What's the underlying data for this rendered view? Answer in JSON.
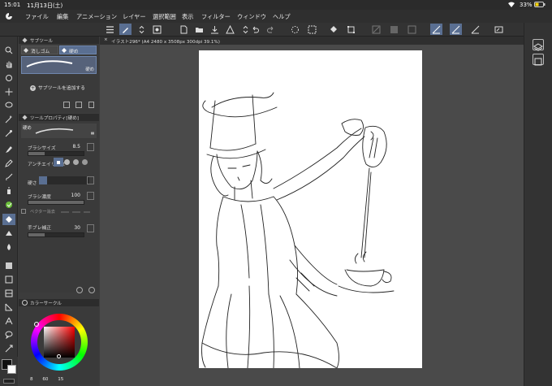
{
  "status": {
    "time": "15:01",
    "date": "11月13日(土)",
    "battery": "33%"
  },
  "menu": [
    "ファイル",
    "編集",
    "アニメーション",
    "レイヤー",
    "選択範囲",
    "表示",
    "フィルター",
    "ウィンドウ",
    "ヘルプ"
  ],
  "subtool_panel": {
    "title": "サブツール",
    "items": [
      {
        "label": "消しゴム",
        "icon": "eraser-icon"
      },
      {
        "label": "硬め",
        "icon": "eraser-hard-icon"
      }
    ],
    "preview_label": "硬め",
    "add_label": "サブツールを追加する"
  },
  "tool_property": {
    "title": "ツールプロパティ[硬め]",
    "tool_name": "硬め",
    "brush_size_label": "ブラシサイズ",
    "brush_size_value": "8.5",
    "antialias_label": "アンチエイリアス",
    "hardness_label": "硬さ",
    "brush_density_label": "ブラシ濃度",
    "brush_density_value": "100",
    "vector_erase_label": "ベクター消去",
    "stabilization_label": "手ブレ補正",
    "stabilization_value": "30"
  },
  "color_panel": {
    "title": "カラーサークル"
  },
  "bottom_values": {
    "a": "8",
    "b": "60",
    "c": "15"
  },
  "document_tab": {
    "label": "イラスト296* (A4 2480 x 3508px 300dpi 39.1%)"
  },
  "colors": {
    "accent": "#5a6f92",
    "panel": "#3a3a3a",
    "canvas": "#ffffff"
  }
}
